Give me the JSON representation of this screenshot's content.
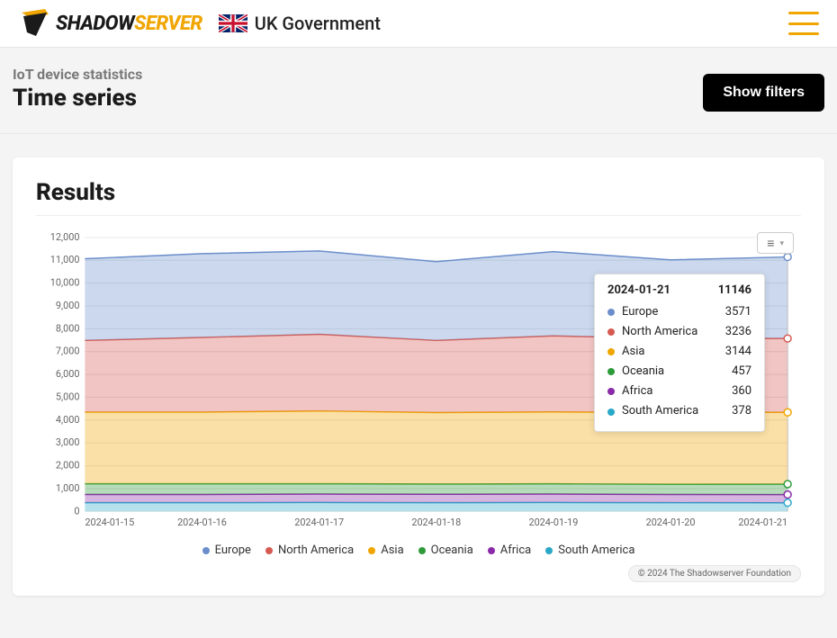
{
  "nav": {
    "brand_shadow": "SHADOW",
    "brand_server": "SERVER",
    "gov_label": "UK Government"
  },
  "header": {
    "subtitle": "IoT device statistics",
    "title": "Time series",
    "show_filters_label": "Show filters"
  },
  "results": {
    "heading": "Results",
    "menu_glyph": "≡",
    "copyright": "© 2024 The Shadowserver Foundation"
  },
  "tooltip": {
    "date": "2024-01-21",
    "total": "11146"
  },
  "chart_data": {
    "type": "area",
    "stacked": true,
    "xlabel": "",
    "ylabel": "",
    "ylim": [
      0,
      12000
    ],
    "yticks": [
      0,
      1000,
      2000,
      3000,
      4000,
      5000,
      6000,
      7000,
      8000,
      9000,
      10000,
      11000,
      12000
    ],
    "categories": [
      "2024-01-15",
      "2024-01-16",
      "2024-01-17",
      "2024-01-18",
      "2024-01-19",
      "2024-01-20",
      "2024-01-21"
    ],
    "series": [
      {
        "name": "Europe",
        "color": "#6b8ecb",
        "values": [
          3580,
          3670,
          3650,
          3450,
          3690,
          3450,
          3571
        ]
      },
      {
        "name": "North America",
        "color": "#d65a52",
        "values": [
          3140,
          3270,
          3360,
          3160,
          3330,
          3240,
          3236
        ]
      },
      {
        "name": "Asia",
        "color": "#f0a500",
        "values": [
          3140,
          3140,
          3190,
          3130,
          3150,
          3140,
          3144
        ]
      },
      {
        "name": "Oceania",
        "color": "#2e9b3a",
        "values": [
          470,
          470,
          450,
          450,
          450,
          450,
          457
        ]
      },
      {
        "name": "Africa",
        "color": "#8a2aa8",
        "values": [
          360,
          360,
          370,
          370,
          370,
          360,
          360
        ]
      },
      {
        "name": "South America",
        "color": "#2aa8c8",
        "values": [
          380,
          380,
          390,
          380,
          390,
          380,
          378
        ]
      }
    ],
    "legend_position": "bottom",
    "grid": true
  }
}
